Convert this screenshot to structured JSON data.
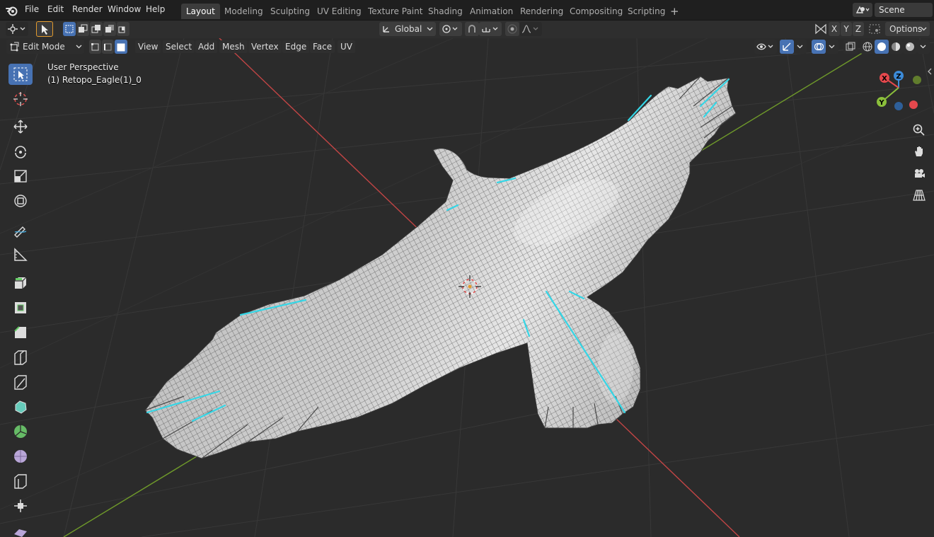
{
  "topbar": {
    "menus": [
      "File",
      "Edit",
      "Render",
      "Window",
      "Help"
    ],
    "workspaces": [
      "Layout",
      "Modeling",
      "Sculpting",
      "UV Editing",
      "Texture Paint",
      "Shading",
      "Animation",
      "Rendering",
      "Compositing",
      "Scripting"
    ],
    "active_workspace": "Layout",
    "add_workspace": "+",
    "scene_name": "Scene"
  },
  "toolheader": {
    "orientation": "Global",
    "axes": [
      "X",
      "Y",
      "Z"
    ],
    "options_label": "Options"
  },
  "modeheader": {
    "mode": "Edit Mode",
    "menus": [
      "View",
      "Select",
      "Add",
      "Mesh",
      "Vertex",
      "Edge",
      "Face",
      "UV"
    ]
  },
  "viewport": {
    "perspective_label": "User Perspective",
    "object_label": "(1) Retopo_Eagle(1)_0"
  },
  "gizmo": {
    "x_label": "X",
    "y_label": "Y",
    "z_label": "Z",
    "colors": {
      "x": "#e5484d",
      "y": "#8bbf3b",
      "z": "#3c8bd9"
    }
  },
  "toolbar": {
    "tools": [
      "select-box",
      "cursor",
      "move",
      "rotate",
      "scale",
      "transform",
      "annotate",
      "measure",
      "extrude-region",
      "inset-faces",
      "bevel",
      "loop-cut",
      "knife",
      "poly-build",
      "spin",
      "smooth",
      "edge-slide",
      "shrink-fatten",
      "shear"
    ]
  },
  "colors": {
    "accent": "#4772b3",
    "axis_x": "#c24545",
    "axis_y": "#6f9a2a",
    "selected_edge": "#35d6e6"
  }
}
